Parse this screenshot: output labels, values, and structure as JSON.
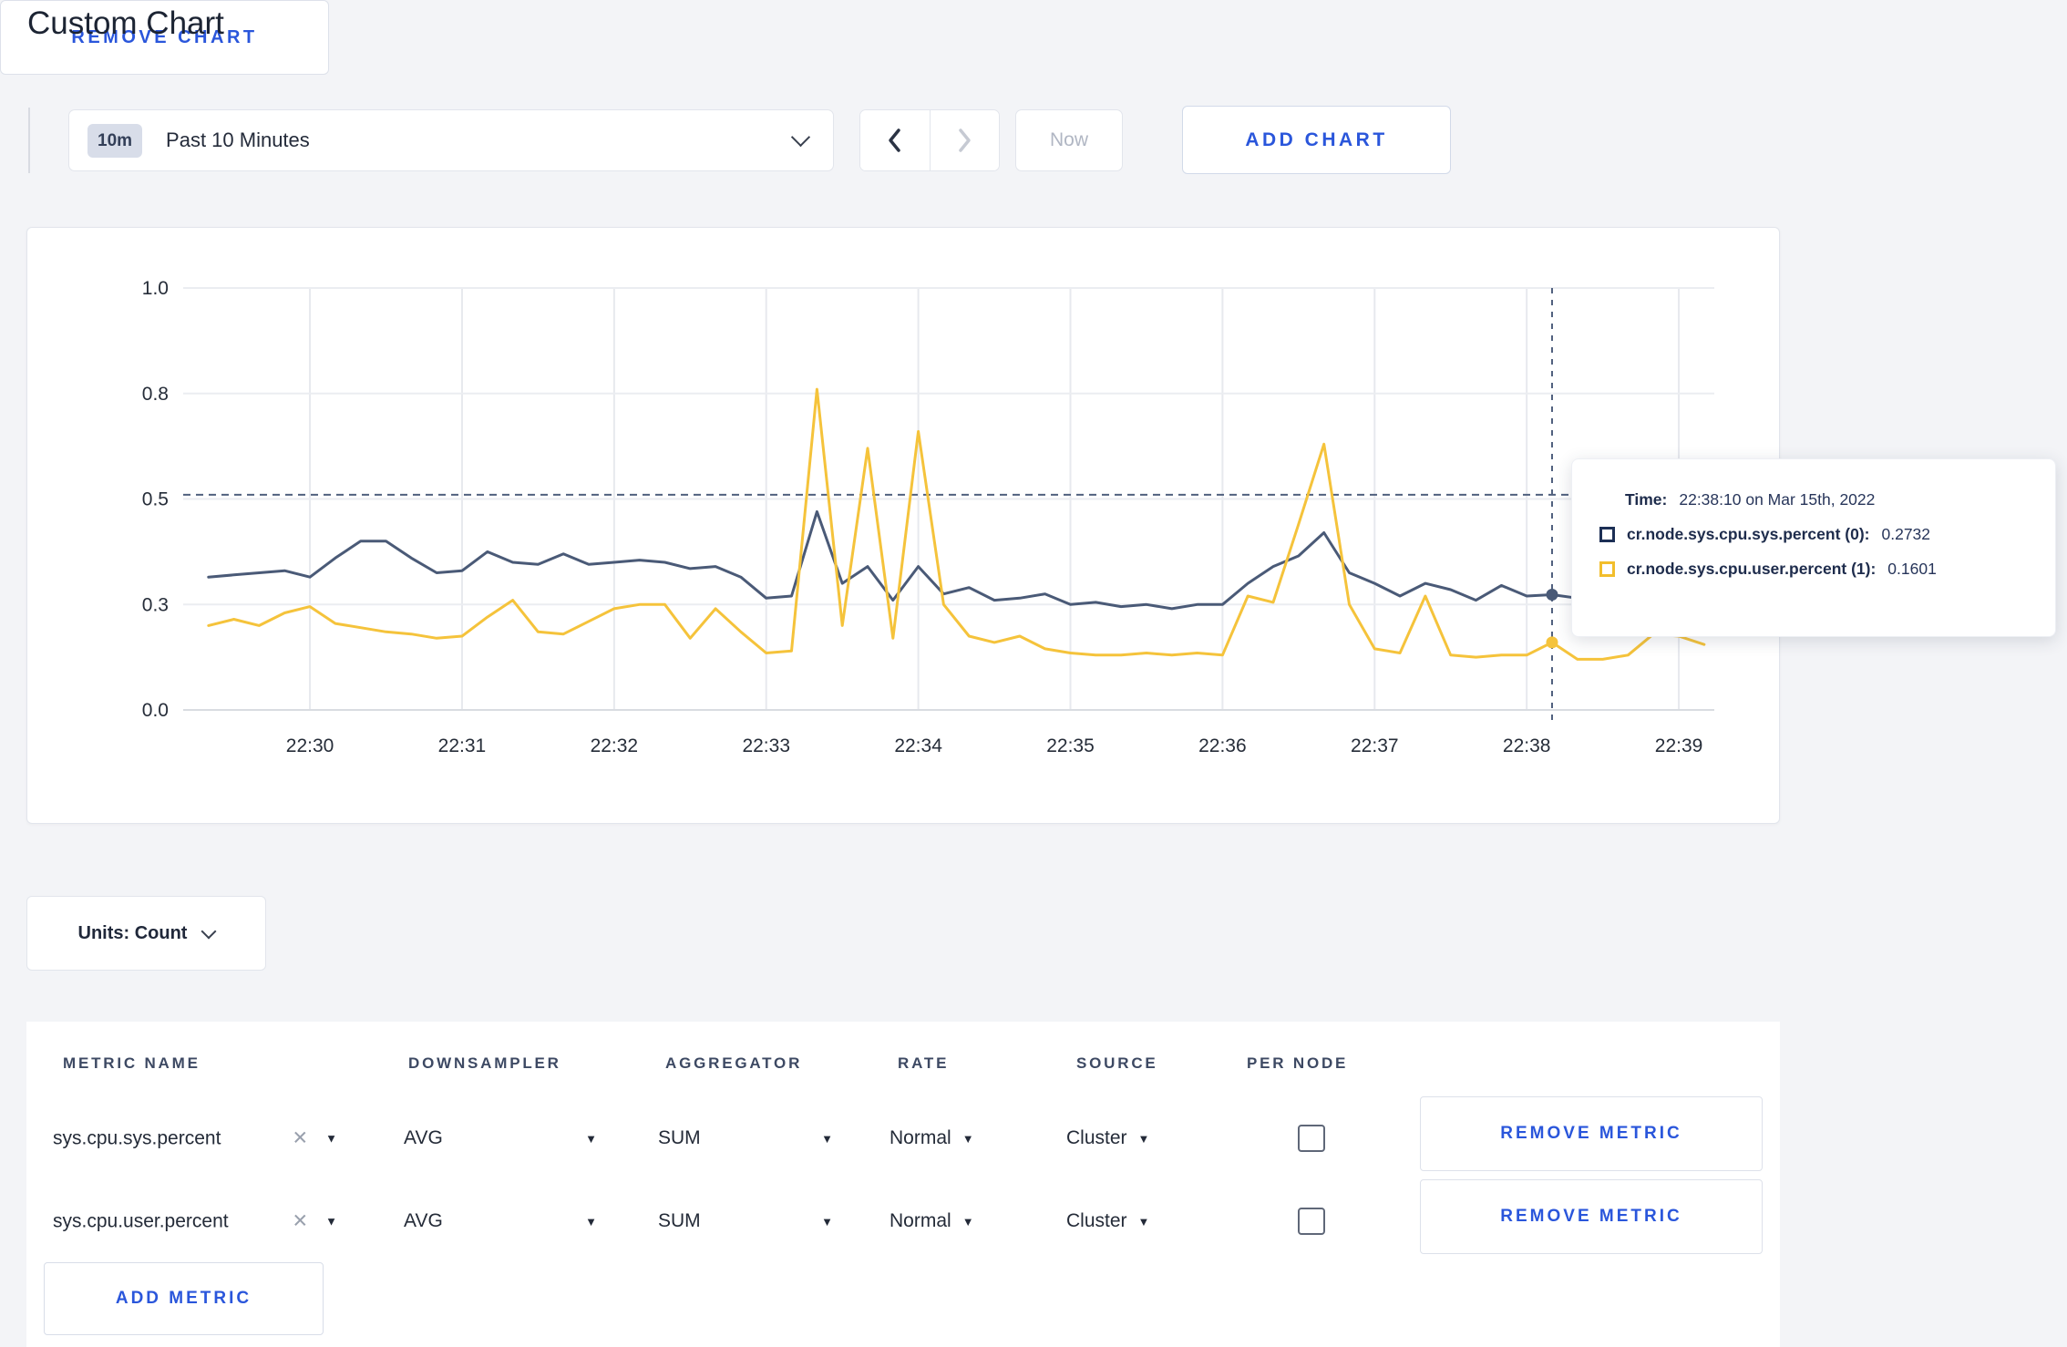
{
  "page": {
    "title": "Custom Chart"
  },
  "toolbar": {
    "time_badge": "10m",
    "time_label": "Past 10 Minutes",
    "now_label": "Now",
    "add_chart_label": "ADD CHART"
  },
  "icons": {
    "caret_down": "▼",
    "close": "✕"
  },
  "chart_tooltip": {
    "time_label": "Time:",
    "time_value": "22:38:10 on Mar 15th, 2022",
    "series": [
      {
        "name": "cr.node.sys.cpu.sys.percent (0):",
        "value": "0.2732",
        "swatch": "#1c2f55"
      },
      {
        "name": "cr.node.sys.cpu.user.percent (1):",
        "value": "0.1601",
        "swatch": "#f2be2c"
      }
    ]
  },
  "units_select_label": "Units: Count",
  "remove_chart_label": "REMOVE CHART",
  "metrics_table": {
    "columns": [
      "METRIC NAME",
      "DOWNSAMPLER",
      "AGGREGATOR",
      "RATE",
      "SOURCE",
      "PER NODE"
    ],
    "rows": [
      {
        "metric": "sys.cpu.sys.percent",
        "downsampler": "AVG",
        "aggregator": "SUM",
        "rate": "Normal",
        "source": "Cluster",
        "per_node_checked": false,
        "remove_label": "REMOVE METRIC"
      },
      {
        "metric": "sys.cpu.user.percent",
        "downsampler": "AVG",
        "aggregator": "SUM",
        "rate": "Normal",
        "source": "Cluster",
        "per_node_checked": false,
        "remove_label": "REMOVE METRIC"
      }
    ],
    "add_metric_label": "ADD METRIC"
  },
  "chart_data": {
    "type": "line",
    "title": "",
    "xlabel": "",
    "ylabel": "",
    "ylim": [
      0,
      1
    ],
    "grid": true,
    "x_start": "22:29:20",
    "x_step_seconds": 10,
    "x_ticks": [
      "22:30",
      "22:31",
      "22:32",
      "22:33",
      "22:34",
      "22:35",
      "22:36",
      "22:37",
      "22:38",
      "22:39"
    ],
    "y_ticks": {
      "values": [
        0,
        0.25,
        0.5,
        0.75,
        1
      ],
      "labels": [
        "0.0",
        "0.3",
        "0.5",
        "0.8",
        "1.0"
      ]
    },
    "series": [
      {
        "name": "cr.node.sys.cpu.sys.percent",
        "color": "#4a5a77",
        "values": [
          0.315,
          0.32,
          0.325,
          0.33,
          0.315,
          0.36,
          0.4,
          0.4,
          0.36,
          0.325,
          0.33,
          0.375,
          0.35,
          0.345,
          0.37,
          0.345,
          0.35,
          0.355,
          0.35,
          0.335,
          0.34,
          0.315,
          0.265,
          0.27,
          0.47,
          0.3,
          0.34,
          0.26,
          0.34,
          0.275,
          0.29,
          0.26,
          0.265,
          0.275,
          0.25,
          0.255,
          0.245,
          0.25,
          0.24,
          0.25,
          0.25,
          0.3,
          0.34,
          0.365,
          0.42,
          0.325,
          0.3,
          0.27,
          0.3,
          0.285,
          0.26,
          0.295,
          0.27,
          0.2732,
          0.265,
          0.255,
          0.26,
          0.27,
          0.285,
          0.27
        ]
      },
      {
        "name": "cr.node.sys.cpu.user.percent",
        "color": "#f5c33b",
        "values": [
          0.2,
          0.215,
          0.2,
          0.23,
          0.245,
          0.205,
          0.195,
          0.185,
          0.18,
          0.17,
          0.175,
          0.22,
          0.26,
          0.185,
          0.18,
          0.21,
          0.24,
          0.25,
          0.25,
          0.17,
          0.24,
          0.185,
          0.135,
          0.14,
          0.76,
          0.2,
          0.62,
          0.17,
          0.66,
          0.25,
          0.175,
          0.16,
          0.175,
          0.145,
          0.135,
          0.13,
          0.13,
          0.135,
          0.13,
          0.135,
          0.13,
          0.27,
          0.255,
          0.44,
          0.63,
          0.25,
          0.145,
          0.135,
          0.27,
          0.13,
          0.125,
          0.13,
          0.13,
          0.1601,
          0.12,
          0.12,
          0.13,
          0.18,
          0.175,
          0.155
        ]
      }
    ],
    "crosshair": {
      "time": "22:38:10",
      "index": 53,
      "y_line_value": 0.51,
      "color": "#50607e"
    },
    "legend_position": "tooltip"
  }
}
